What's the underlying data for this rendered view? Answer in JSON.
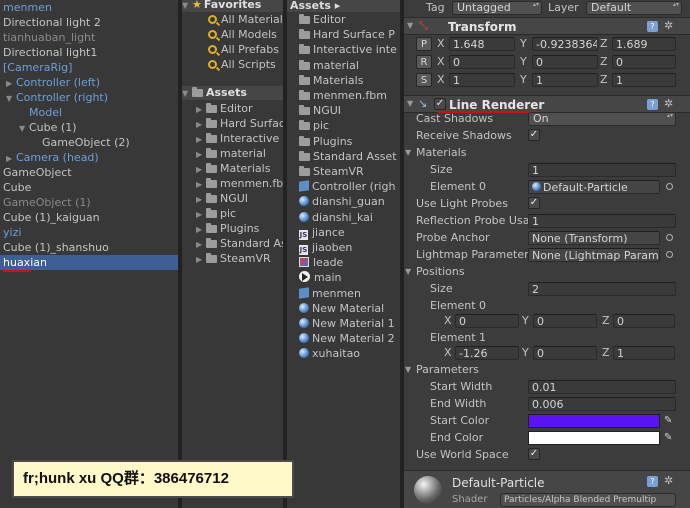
{
  "hierarchy": {
    "items": [
      {
        "label": "menmen",
        "style": "prefab",
        "indent": 0,
        "arrow": ""
      },
      {
        "label": "Directional light 2",
        "style": "normal",
        "indent": 0,
        "arrow": ""
      },
      {
        "label": "tianhuaban_light",
        "style": "inactive",
        "indent": 0,
        "arrow": ""
      },
      {
        "label": "Directional light1",
        "style": "normal",
        "indent": 0,
        "arrow": ""
      },
      {
        "label": "[CameraRig]",
        "style": "prefab",
        "indent": 0,
        "arrow": ""
      },
      {
        "label": "Controller (left)",
        "style": "prefab",
        "indent": 1,
        "arrow": "▶"
      },
      {
        "label": "Controller (right)",
        "style": "prefab",
        "indent": 1,
        "arrow": "▼"
      },
      {
        "label": "Model",
        "style": "prefab",
        "indent": 2,
        "arrow": ""
      },
      {
        "label": "Cube (1)",
        "style": "normal",
        "indent": 2,
        "arrow": "▼"
      },
      {
        "label": "GameObject (2)",
        "style": "normal",
        "indent": 3,
        "arrow": ""
      },
      {
        "label": "Camera (head)",
        "style": "prefab",
        "indent": 1,
        "arrow": "▶"
      },
      {
        "label": "GameObject",
        "style": "normal",
        "indent": 0,
        "arrow": ""
      },
      {
        "label": "Cube",
        "style": "normal",
        "indent": 0,
        "arrow": ""
      },
      {
        "label": "GameObject (1)",
        "style": "inactive",
        "indent": 0,
        "arrow": ""
      },
      {
        "label": "Cube (1)_kaiguan",
        "style": "normal",
        "indent": 0,
        "arrow": ""
      },
      {
        "label": "yizi",
        "style": "prefab",
        "indent": 0,
        "arrow": ""
      },
      {
        "label": "Cube (1)_shanshuo",
        "style": "normal",
        "indent": 0,
        "arrow": ""
      },
      {
        "label": "huaxian",
        "style": "selected",
        "indent": 0,
        "arrow": ""
      }
    ]
  },
  "favorites": {
    "header": "Favorites",
    "items": [
      "All Materials",
      "All Models",
      "All Prefabs",
      "All Scripts"
    ]
  },
  "tree": {
    "header": "Assets",
    "items": [
      "Editor",
      "Hard Surface",
      "Interactive",
      "material",
      "Materials",
      "menmen.fbm",
      "NGUI",
      "pic",
      "Plugins",
      "Standard Assets",
      "SteamVR"
    ]
  },
  "assets": {
    "header": "Assets ▸",
    "items": [
      {
        "label": "Editor",
        "icon": "folder"
      },
      {
        "label": "Hard Surface P",
        "icon": "folder"
      },
      {
        "label": "Interactive inte",
        "icon": "folder"
      },
      {
        "label": "material",
        "icon": "folder"
      },
      {
        "label": "Materials",
        "icon": "folder"
      },
      {
        "label": "menmen.fbm",
        "icon": "folder"
      },
      {
        "label": "NGUI",
        "icon": "folder"
      },
      {
        "label": "pic",
        "icon": "folder"
      },
      {
        "label": "Plugins",
        "icon": "folder"
      },
      {
        "label": "Standard Asset",
        "icon": "folder"
      },
      {
        "label": "SteamVR",
        "icon": "folder"
      },
      {
        "label": "Controller (righ",
        "icon": "prefab"
      },
      {
        "label": "dianshi_guan",
        "icon": "sphere"
      },
      {
        "label": "dianshi_kai",
        "icon": "sphere"
      },
      {
        "label": "jiance",
        "icon": "script"
      },
      {
        "label": "jiaoben",
        "icon": "script"
      },
      {
        "label": "leade",
        "icon": "image"
      },
      {
        "label": "main",
        "icon": "scene"
      },
      {
        "label": "menmen",
        "icon": "prefab"
      },
      {
        "label": "New Material",
        "icon": "sphere"
      },
      {
        "label": "New Material 1",
        "icon": "sphere"
      },
      {
        "label": "New Material 2",
        "icon": "sphere"
      },
      {
        "label": "xuhaitao",
        "icon": "sphere"
      }
    ]
  },
  "inspector": {
    "tag_label": "Tag",
    "tag_value": "Untagged",
    "layer_label": "Layer",
    "layer_value": "Default",
    "transform": {
      "title": "Transform",
      "p_btn": "P",
      "r_btn": "R",
      "s_btn": "S",
      "x": "X",
      "y": "Y",
      "z": "Z",
      "pos": [
        "1.648",
        "-0.9238364",
        "1.689"
      ],
      "rot": [
        "0",
        "0",
        "0"
      ],
      "scale": [
        "1",
        "1",
        "1"
      ]
    },
    "line_renderer": {
      "title": "Line Renderer",
      "cast_shadows_label": "Cast Shadows",
      "cast_shadows_value": "On",
      "receive_shadows_label": "Receive Shadows",
      "materials_label": "Materials",
      "size_label": "Size",
      "size_value": "1",
      "element0_label": "Element 0",
      "element0_value": "Default-Particle",
      "use_light_probes_label": "Use Light Probes",
      "reflection_probe_label": "Reflection Probe Usa",
      "reflection_probe_value": "1",
      "probe_anchor_label": "Probe Anchor",
      "probe_anchor_value": "None (Transform)",
      "lightmap_label": "Lightmap Parameter",
      "lightmap_value": "None (Lightmap Parame",
      "positions_label": "Positions",
      "pos_size_label": "Size",
      "pos_size_value": "2",
      "pos_el0_label": "Element 0",
      "pos_el0": [
        "0",
        "0",
        "0"
      ],
      "pos_el1_label": "Element 1",
      "pos_el1": [
        "-1.26",
        "0",
        "1"
      ],
      "parameters_label": "Parameters",
      "start_width_label": "Start Width",
      "start_width_value": "0.01",
      "end_width_label": "End Width",
      "end_width_value": "0.006",
      "start_color_label": "Start Color",
      "end_color_label": "End Color",
      "use_world_space_label": "Use World Space",
      "check_mark": "✓"
    },
    "material": {
      "name": "Default-Particle",
      "shader_label": "Shader",
      "shader_value": "Particles/Alpha Blended Premultip"
    }
  },
  "banner": {
    "text": "fr;hunk xu QQ群：386476712"
  },
  "colors": {
    "selection": "#3e5f96",
    "prefab_text": "#6d9fd9",
    "start_color": "#5a14f0",
    "end_color": "#ffffff",
    "annotation_red": "#d01010",
    "banner_bg": "#fff8c8"
  }
}
